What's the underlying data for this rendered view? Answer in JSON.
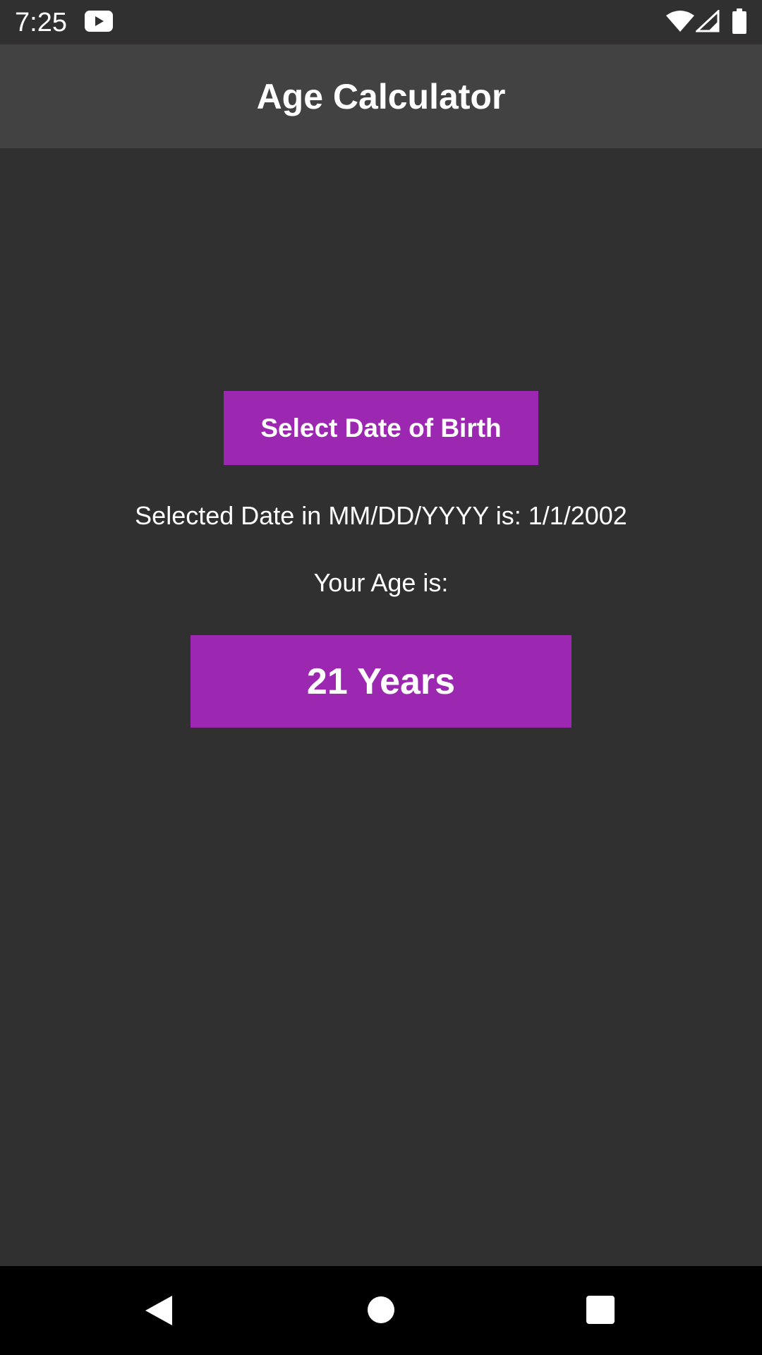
{
  "status_bar": {
    "time": "7:25",
    "icons": [
      "youtube-icon",
      "wifi-icon",
      "signal-icon",
      "battery-icon"
    ]
  },
  "app_bar": {
    "title": "Age Calculator"
  },
  "main": {
    "select_button_label": "Select Date of Birth",
    "selected_date_text": "Selected Date in MM/DD/YYYY is: 1/1/2002",
    "age_label": "Your Age is:",
    "age_value": "21 Years"
  },
  "nav_bar": {
    "icons": [
      "back-icon",
      "home-icon",
      "recents-icon"
    ]
  },
  "colors": {
    "background": "#303030",
    "app_bar": "#424242",
    "accent": "#9c27b0",
    "nav_bar": "#000000",
    "text": "#ffffff"
  }
}
